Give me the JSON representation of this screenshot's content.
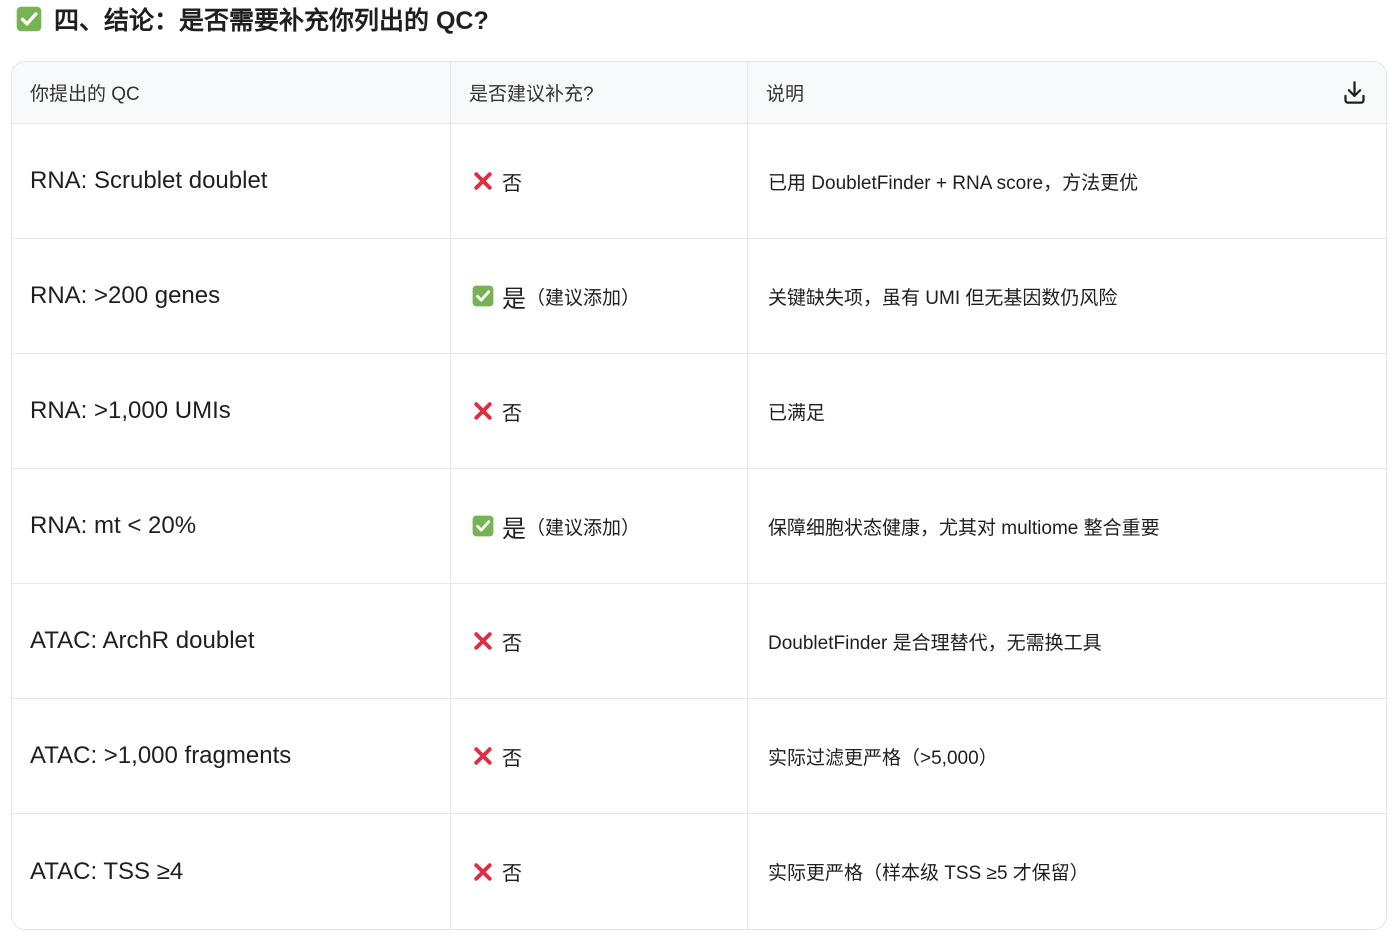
{
  "colors": {
    "check_green": "#77b255",
    "cross_red": "#dd2e44"
  },
  "heading": {
    "icon": "check-mark-icon",
    "title": "四、结论：是否需要补充你列出的 QC?"
  },
  "table": {
    "headers": {
      "qc": "你提出的 QC",
      "recommend": "是否建议补充?",
      "description": "说明"
    },
    "download_icon": "download-icon",
    "rows": [
      {
        "qc": "RNA: Scrublet doublet",
        "icon": "cross-icon",
        "answer": "否",
        "description": "已用 DoubletFinder + RNA score，方法更优"
      },
      {
        "qc": "RNA: >200 genes",
        "icon": "check-mark-icon",
        "answer": "是",
        "note": "（建议添加）",
        "description": "关键缺失项，虽有 UMI 但无基因数仍风险"
      },
      {
        "qc": "RNA: >1,000 UMIs",
        "icon": "cross-icon",
        "answer": "否",
        "description": "已满足"
      },
      {
        "qc": "RNA: mt < 20%",
        "icon": "check-mark-icon",
        "answer": "是",
        "note": "（建议添加）",
        "description": "保障细胞状态健康，尤其对 multiome 整合重要"
      },
      {
        "qc": "ATAC: ArchR doublet",
        "icon": "cross-icon",
        "answer": "否",
        "description": "DoubletFinder 是合理替代，无需换工具"
      },
      {
        "qc": "ATAC: >1,000 fragments",
        "icon": "cross-icon",
        "answer": "否",
        "description": "实际过滤更严格（>5,000）"
      },
      {
        "qc": "ATAC: TSS ≥4",
        "icon": "cross-icon",
        "answer": "否",
        "description": "实际更严格（样本级 TSS ≥5 才保留）"
      }
    ]
  }
}
